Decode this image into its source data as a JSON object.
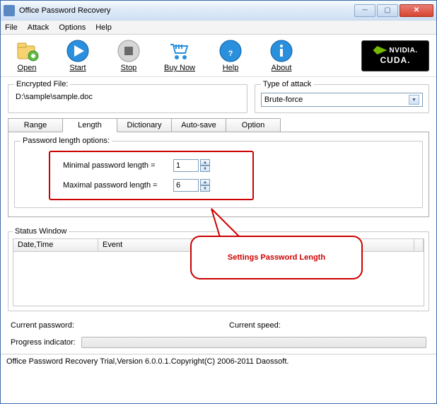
{
  "title": "Office Password Recovery",
  "menu": {
    "file": "File",
    "attack": "Attack",
    "options": "Options",
    "help": "Help"
  },
  "toolbar": {
    "open": "Open",
    "start": "Start",
    "stop": "Stop",
    "buy": "Buy Now",
    "help": "Help",
    "about": "About",
    "nvidia_brand": "NVIDIA.",
    "nvidia_cuda": "CUDA."
  },
  "enc": {
    "legend": "Encrypted File:",
    "path": "D:\\sample\\sample.doc"
  },
  "attack": {
    "legend": "Type of attack",
    "value": "Brute-force"
  },
  "tabs": {
    "range": "Range",
    "length": "Length",
    "dictionary": "Dictionary",
    "autosave": "Auto-save",
    "option": "Option"
  },
  "plo": {
    "legend": "Password length options:",
    "min_label": "Minimal password length  =",
    "min_value": "1",
    "max_label": "Maximal password length  =",
    "max_value": "6"
  },
  "callout": "Settings Password Length",
  "status": {
    "legend": "Status Window",
    "col1": "Date,Time",
    "col2": "Event"
  },
  "bottom": {
    "curpwd": "Current password:",
    "curspeed": "Current speed:",
    "prog": "Progress indicator:"
  },
  "statusbar": "Office Password Recovery Trial,Version 6.0.0.1.Copyright(C) 2006-2011 Daossoft."
}
